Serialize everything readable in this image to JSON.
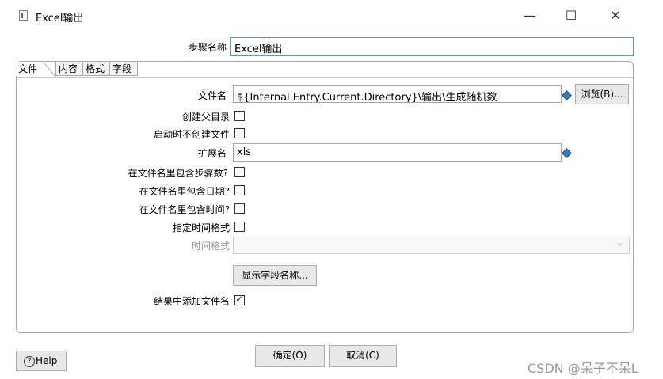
{
  "window": {
    "title": "Excel输出",
    "minimize": "—",
    "maximize": "☐",
    "close": "✕"
  },
  "step_name": {
    "label": "步骤名称",
    "value": "Excel输出"
  },
  "tabs": [
    {
      "label": "文件"
    },
    {
      "label": "内容"
    },
    {
      "label": "格式"
    },
    {
      "label": "字段"
    }
  ],
  "file_tab": {
    "filename": {
      "label": "文件名",
      "value": "${Internal.Entry.Current.Directory}\\输出\\生成随机数",
      "browse_label": "浏览(B)..."
    },
    "create_parent_dir": {
      "label": "创建父目录",
      "checked": false
    },
    "no_create_at_start": {
      "label": "启动时不创建文件",
      "checked": false
    },
    "extension": {
      "label": "扩展名",
      "value": "xls"
    },
    "include_stepnr": {
      "label": "在文件名里包含步骤数?",
      "checked": false
    },
    "include_date": {
      "label": "在文件名里包含日期?",
      "checked": false
    },
    "include_time": {
      "label": "在文件名里包含时间?",
      "checked": false
    },
    "specify_format": {
      "label": "指定时间格式",
      "checked": false
    },
    "time_format": {
      "label": "时间格式",
      "value": ""
    },
    "show_fields_label": "显示字段名称...",
    "add_to_result": {
      "label": "结果中添加文件名",
      "checked": true
    }
  },
  "footer": {
    "help_label": "Help",
    "ok_label": "确定(O)",
    "cancel_label": "取消(C)"
  },
  "watermark": "CSDN @呆子不呆L",
  "colors": {
    "focus_border": "#4a9fd8",
    "variable_diamond": "#3a7bbf",
    "button_bg": "#e8e8e8"
  }
}
